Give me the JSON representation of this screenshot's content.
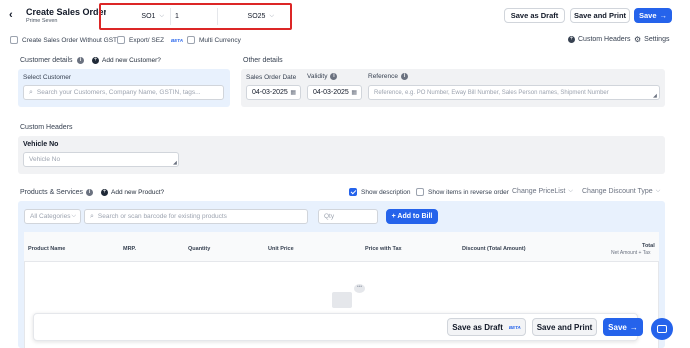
{
  "header": {
    "title": "Create Sales Order",
    "company": "Prime Seven",
    "series_prefix": "SO1",
    "series_number": "1",
    "series_suffix": "SO25",
    "save_draft_label": "Save as Draft",
    "save_print_label": "Save and Print",
    "save_label": "Save"
  },
  "options": {
    "without_gst_label": "Create Sales Order Without GST",
    "export_label": "Export/ SEZ",
    "beta_badge": "BETA",
    "multi_currency_label": "Multi Currency",
    "custom_headers_link": "Custom Headers",
    "settings_link": "Settings"
  },
  "customer": {
    "section_label": "Customer details",
    "add_new_label": "Add new Customer?",
    "select_label": "Select Customer",
    "search_placeholder": "Search your Customers, Company Name, GSTIN, tags..."
  },
  "other_details": {
    "section_label": "Other details",
    "order_date_label": "Sales Order Date",
    "order_date_value": "04-03-2025",
    "validity_label": "Validity",
    "validity_value": "04-03-2025",
    "reference_label": "Reference",
    "reference_placeholder": "Reference, e.g. PO Number, Eway Bill Number, Sales Person names, Shipment Number"
  },
  "custom_headers": {
    "section_label": "Custom Headers",
    "vehicle_label": "Vehicle No",
    "vehicle_placeholder": "Vehicle No"
  },
  "products": {
    "section_label": "Products & Services",
    "add_new_label": "Add new Product?",
    "show_description_label": "Show description",
    "reverse_order_label": "Show items in reverse order",
    "change_pricelist_label": "Change PriceList",
    "change_discount_label": "Change Discount Type",
    "category_placeholder": "All Categories",
    "search_placeholder": "Search or scan barcode for existing products",
    "qty_placeholder": "Qty",
    "add_to_bill_label": "+ Add to Bill",
    "columns": {
      "product_name": "Product Name",
      "mrp": "MRP.",
      "quantity": "Quantity",
      "unit_price": "Unit Price",
      "price_with_tax": "Price with Tax",
      "discount": "Discount (Total Amount)",
      "total": "Total",
      "total_sub": "Net Amount + Tax"
    }
  },
  "footer": {
    "save_draft_label": "Save as Draft",
    "beta_badge": "BETA",
    "save_print_label": "Save and Print",
    "save_label": "Save"
  }
}
